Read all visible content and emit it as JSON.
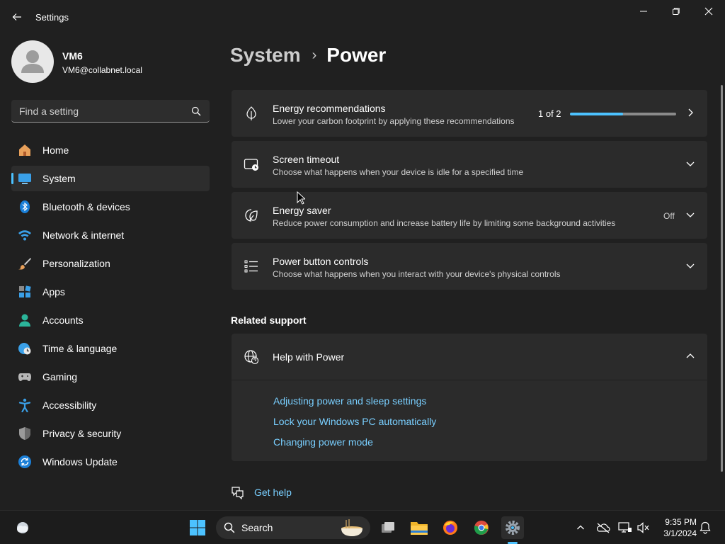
{
  "window": {
    "title": "Settings"
  },
  "profile": {
    "name": "VM6",
    "email": "VM6@collabnet.local"
  },
  "search": {
    "placeholder": "Find a setting"
  },
  "sidebar": {
    "items": [
      {
        "label": "Home",
        "icon": "home-icon",
        "selected": false
      },
      {
        "label": "System",
        "icon": "system-icon",
        "selected": true
      },
      {
        "label": "Bluetooth & devices",
        "icon": "bluetooth-icon",
        "selected": false
      },
      {
        "label": "Network & internet",
        "icon": "wifi-icon",
        "selected": false
      },
      {
        "label": "Personalization",
        "icon": "brush-icon",
        "selected": false
      },
      {
        "label": "Apps",
        "icon": "apps-icon",
        "selected": false
      },
      {
        "label": "Accounts",
        "icon": "accounts-icon",
        "selected": false
      },
      {
        "label": "Time & language",
        "icon": "globe-clock-icon",
        "selected": false
      },
      {
        "label": "Gaming",
        "icon": "gamepad-icon",
        "selected": false
      },
      {
        "label": "Accessibility",
        "icon": "accessibility-icon",
        "selected": false
      },
      {
        "label": "Privacy & security",
        "icon": "shield-icon",
        "selected": false
      },
      {
        "label": "Windows Update",
        "icon": "update-icon",
        "selected": false
      }
    ]
  },
  "breadcrumb": {
    "parent": "System",
    "separator": "›",
    "current": "Power"
  },
  "cards": {
    "energy_recommendations": {
      "title": "Energy recommendations",
      "subtitle": "Lower your carbon footprint by applying these recommendations",
      "count": "1 of 2",
      "progress_fraction": 0.5
    },
    "screen_timeout": {
      "title": "Screen timeout",
      "subtitle": "Choose what happens when your device is idle for a specified time"
    },
    "energy_saver": {
      "title": "Energy saver",
      "subtitle": "Reduce power consumption and increase battery life by limiting some background activities",
      "state": "Off"
    },
    "power_button_controls": {
      "title": "Power button controls",
      "subtitle": "Choose what happens when you interact with your device's physical controls"
    }
  },
  "related_support": {
    "heading": "Related support",
    "help_title": "Help with Power",
    "links": [
      "Adjusting power and sleep settings",
      "Lock your Windows PC automatically",
      "Changing power mode"
    ]
  },
  "get_help": {
    "label": "Get help"
  },
  "taskbar": {
    "search_label": "Search",
    "time": "9:35 PM",
    "date": "3/1/2024"
  },
  "colors": {
    "accent": "#4cc2ff",
    "link": "#79cfff",
    "background": "#202020",
    "card": "#2b2b2b"
  }
}
